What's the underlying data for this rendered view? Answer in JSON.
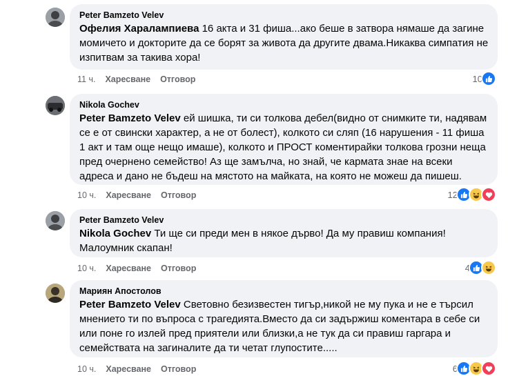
{
  "comments": [
    {
      "author": "Peter Bamzeto Velev",
      "mention": "Офелия Харалампиева",
      "text": " 16 акта и 31 фиша...ако беше в затвора нямаше да загине момичето и докторите да се борят за живота да другите двама.Никаква симпатия не изпитвам за такива хора!",
      "time": "11 ч.",
      "like_label": "Харесване",
      "reply_label": "Отговор",
      "reaction_count": "10",
      "reactions": [
        "like-icon"
      ]
    },
    {
      "author": "Nikola Gochev",
      "mention": "Peter Bamzeto Velev",
      "text": " ей шишка, ти си толкова дебел(видно от снимките ти, надявам се е от свински характер, а не от болест), колкото си сляп (16 нарушения - 11 фиша 1 акт и там още нещо имаше), колкото и ПРОСТ коментирайки толкова грозни неща пред очернено семейство! Аз ще замълча, но знай, че кармата знае на всеки адреса и дано не бъдеш на мястото на майката, на която не можеш да пишеш.",
      "time": "10 ч.",
      "like_label": "Харесване",
      "reply_label": "Отговор",
      "reaction_count": "12",
      "reactions": [
        "like-icon",
        "haha-icon",
        "love-icon"
      ]
    },
    {
      "author": "Peter Bamzeto Velev",
      "mention": "Nikola Gochev",
      "text": " Ти ще си преди мен в някое дърво! Да му правиш компания! Малоумник скапан!",
      "time": "10 ч.",
      "like_label": "Харесване",
      "reply_label": "Отговор",
      "reaction_count": "4",
      "reactions": [
        "like-icon",
        "haha-icon"
      ]
    },
    {
      "author": "Мариян Апостолов",
      "mention": "Peter Bamzeto Velev",
      "text": " Световно безизвестен тигър,никой не му пука и не е търсил мнението ти по въпроса с трагедията.Вместо да си задържиш коментара в себе си или поне го излей пред приятели или близки,а не тук да си правиш гаргара и семействата на загиналите да ти четат глупостите.....",
      "time": "10 ч.",
      "like_label": "Харесване",
      "reply_label": "Отговор",
      "reaction_count": "6",
      "reactions": [
        "like-icon",
        "haha-icon",
        "love-icon"
      ]
    }
  ],
  "colors": {
    "bubble": "#f0f2f5",
    "meta": "#65676b",
    "like": "#1877f2",
    "haha": "#f7c84a",
    "love": "#f33e58"
  }
}
